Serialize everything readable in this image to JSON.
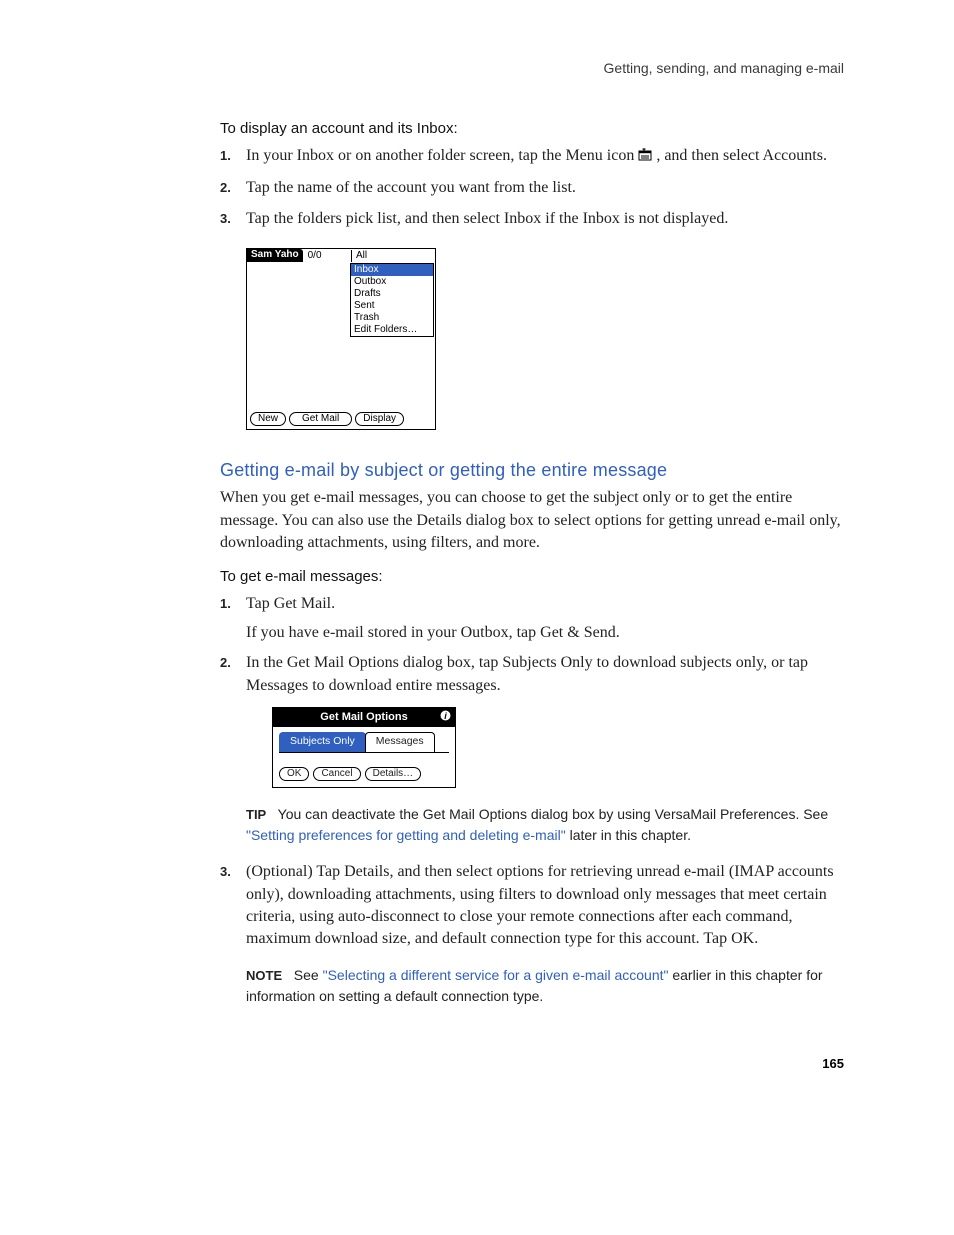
{
  "running_head": "Getting, sending, and managing e-mail",
  "proc1": {
    "heading": "To display an account and its Inbox:",
    "steps": {
      "s1a": "In your Inbox or on another folder screen, tap the Menu icon ",
      "s1b": ", and then select Accounts.",
      "s2": "Tap the name of the account you want from the list.",
      "s3": "Tap the folders pick list, and then select Inbox if the Inbox is not displayed."
    }
  },
  "palm1": {
    "account_tab": "Sam Yaho",
    "count": "0/0",
    "all": "All",
    "folders": {
      "f0": "Inbox",
      "f1": "Outbox",
      "f2": "Drafts",
      "f3": "Sent",
      "f4": "Trash",
      "f5": "Edit Folders…"
    },
    "buttons": {
      "new": "New",
      "getmail": "Get Mail",
      "display": "Display"
    }
  },
  "section2": {
    "heading": "Getting e-mail by subject or getting the entire message",
    "intro": "When you get e-mail messages, you can choose to get the subject only or to get the entire message. You can also use the Details dialog box to select options for getting unread e-mail only, downloading attachments, using filters, and more."
  },
  "proc2": {
    "heading": "To get e-mail messages:",
    "s1a": "Tap Get Mail.",
    "s1b": "If you have e-mail stored in your Outbox, tap Get & Send.",
    "s2": "In the Get Mail Options dialog box, tap Subjects Only to download subjects only, or tap Messages to download entire messages.",
    "s3": "(Optional) Tap Details, and then select options for retrieving unread e-mail (IMAP accounts only), downloading attachments, using filters to download only messages that meet certain criteria, using auto-disconnect to close your remote connections after each command, maximum download size, and default connection type for this account. Tap OK."
  },
  "palm2": {
    "title": "Get Mail Options",
    "tabs": {
      "t0": "Subjects Only",
      "t1": "Messages"
    },
    "buttons": {
      "ok": "OK",
      "cancel": "Cancel",
      "details": "Details…"
    }
  },
  "tip": {
    "label": "TIP",
    "before": "You can deactivate the Get Mail Options dialog box by using VersaMail Preferences. See ",
    "link": "\"Setting preferences for getting and deleting e-mail\"",
    "after": " later in this chapter."
  },
  "note": {
    "label": "NOTE",
    "before": "See ",
    "link": "\"Selecting a different service for a given e-mail account\"",
    "after": " earlier in this chapter for information on setting a default connection type."
  },
  "page_number": "165"
}
